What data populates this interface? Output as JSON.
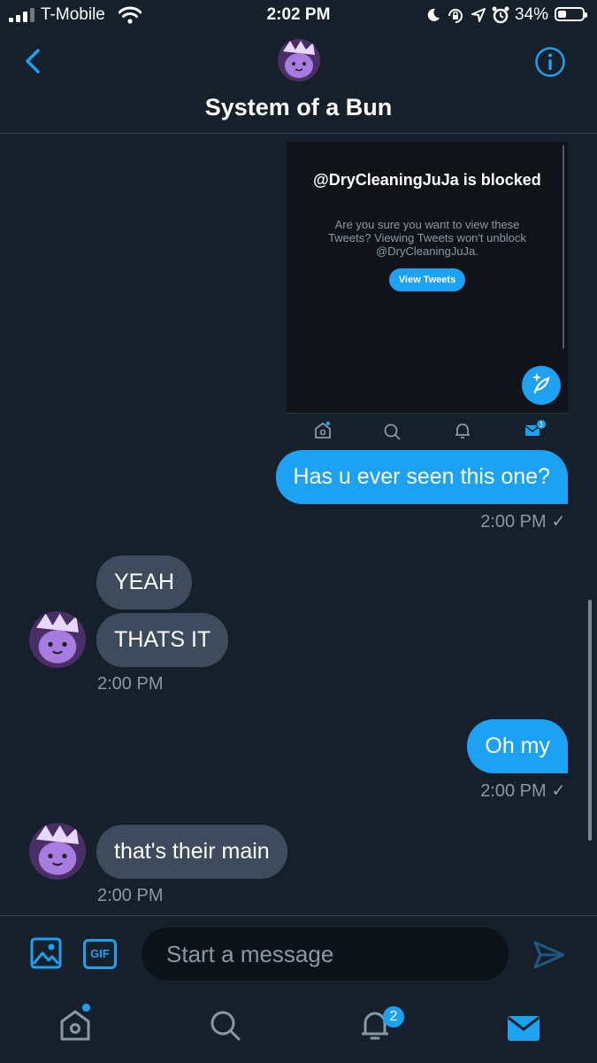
{
  "status_bar": {
    "carrier": "T-Mobile",
    "time": "2:02 PM",
    "battery_percent": "34%",
    "battery_level": 0.34,
    "icons": [
      "signal-icon",
      "wifi-icon",
      "moon-icon",
      "rotation-lock-icon",
      "location-icon",
      "alarm-icon",
      "battery-icon"
    ]
  },
  "header": {
    "title": "System of a Bun",
    "back_icon": "chevron-left-icon",
    "info_icon": "info-icon"
  },
  "shared_image": {
    "title": "@DryCleaningJuJa is blocked",
    "body": "Are you sure you want to view these Tweets? Viewing Tweets won't unblock @DryCleaningJuJa.",
    "button_label": "View Tweets",
    "nav_icons": [
      "home-icon",
      "search-icon",
      "bell-icon",
      "mail-icon"
    ],
    "mail_badge": "1"
  },
  "messages": [
    {
      "direction": "out",
      "text": "Has u ever seen this one?",
      "time": "2:00 PM",
      "status": "✓"
    },
    {
      "direction": "in",
      "text": "YEAH"
    },
    {
      "direction": "in",
      "text": "THATS IT",
      "time": "2:00 PM"
    },
    {
      "direction": "out",
      "text": "Oh my",
      "time": "2:00 PM",
      "status": "✓"
    },
    {
      "direction": "in",
      "text": "that's their main",
      "time": "2:00 PM"
    }
  ],
  "composer": {
    "placeholder": "Start a message",
    "gif_label": "GIF",
    "icons": [
      "image-icon",
      "gif-icon",
      "send-icon"
    ]
  },
  "tab_bar": {
    "icons": [
      "home-icon",
      "search-icon",
      "notifications-icon",
      "messages-icon"
    ],
    "notifications_badge": "2"
  },
  "colors": {
    "background": "#15202b",
    "accent": "#1da1f2",
    "incoming_bubble": "#3d4b5c",
    "muted_text": "#8899a6"
  }
}
